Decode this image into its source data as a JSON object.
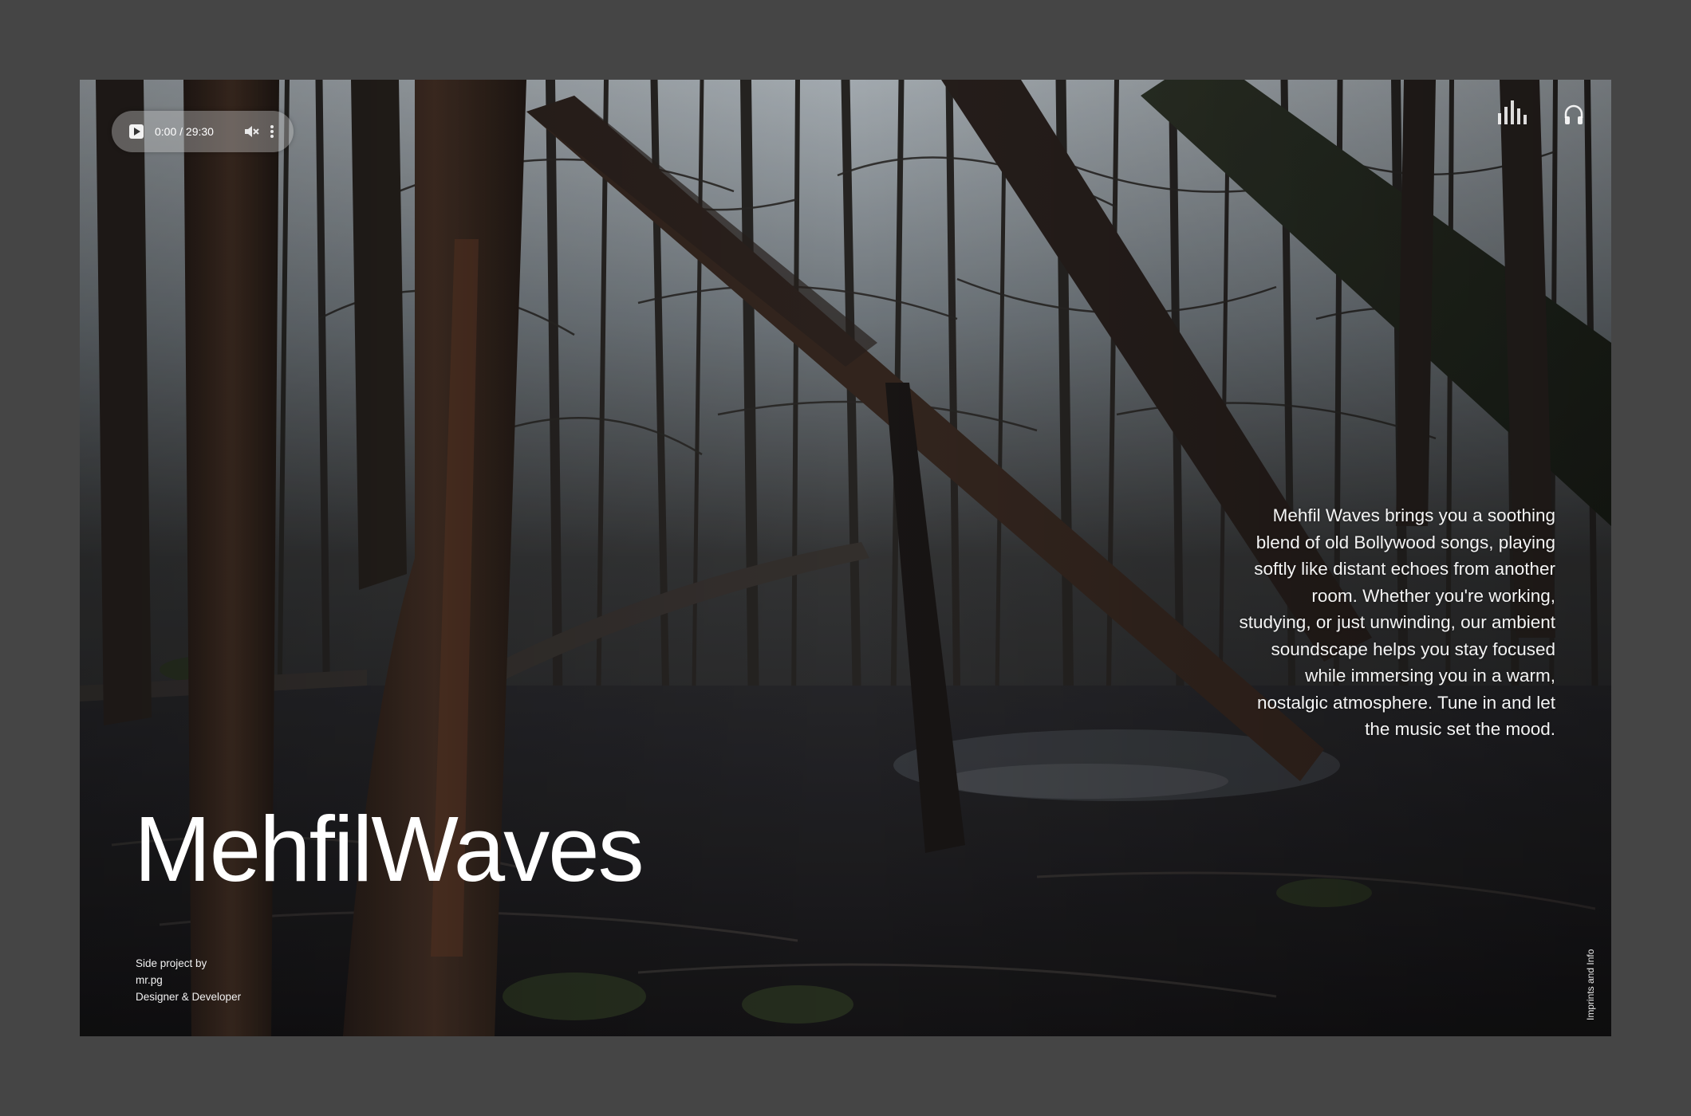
{
  "player": {
    "time_label": "0:00 / 29:30",
    "play_icon": "play-icon",
    "mute_icon": "mute-icon",
    "more_icon": "more-vertical-icon"
  },
  "top_right": {
    "equalizer_icon": "equalizer-icon",
    "headphone_icon": "headphone-icon"
  },
  "hero": {
    "description": "Mehfil Waves brings you a soothing blend of old Bollywood songs, playing softly like distant echoes from another room. Whether you're working, studying, or just unwinding, our ambient soundscape helps you stay focused while immersing you in a warm, nostalgic atmosphere. Tune in and let the music set the mood.",
    "title": "MehfilWaves"
  },
  "credits": {
    "line1": "Side project by",
    "line2": "mr.pg",
    "line3": "Designer & Developer"
  },
  "footer": {
    "imprint_link": "Imprints and Info"
  },
  "colors": {
    "page_background": "#454545",
    "text": "#ffffff",
    "player_pill": "rgba(190,190,190,0.42)"
  }
}
